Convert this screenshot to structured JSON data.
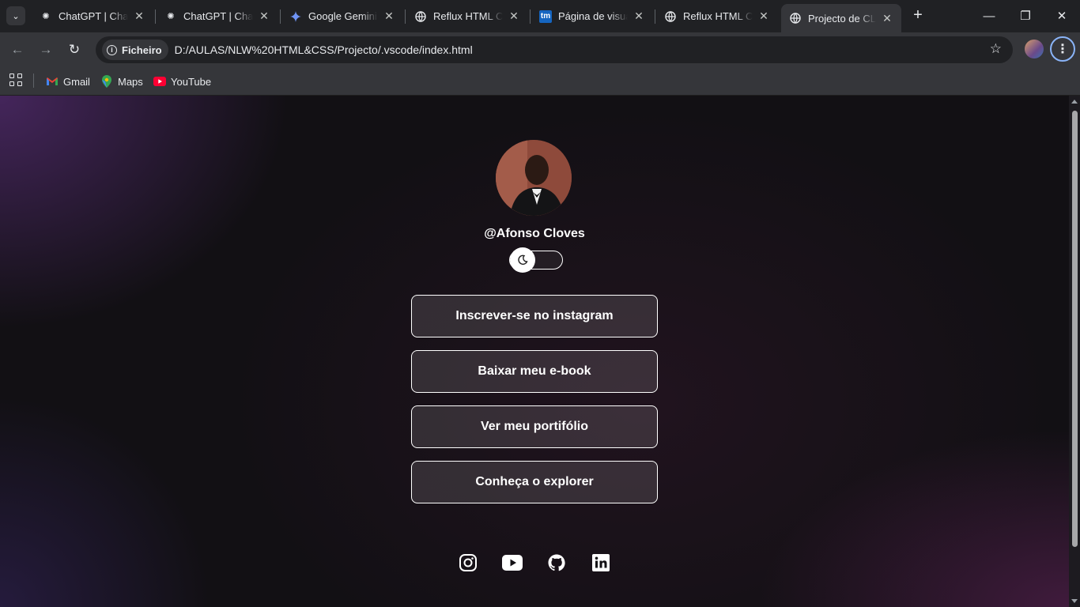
{
  "tabs": [
    {
      "title": "ChatGPT | Chat com IA",
      "favicon": "openai-icon"
    },
    {
      "title": "ChatGPT | Chat com IA",
      "favicon": "openai-icon"
    },
    {
      "title": "Google Gemini",
      "favicon": "gemini-icon"
    },
    {
      "title": "Reflux HTML CSS",
      "favicon": "globe-icon"
    },
    {
      "title": "Página de visualização",
      "favicon": "tm-icon",
      "favicon_text": "tm"
    },
    {
      "title": "Reflux HTML CSS",
      "favicon": "globe-icon"
    },
    {
      "title": "Projecto de CLOVES",
      "favicon": "globe-icon",
      "active": true
    }
  ],
  "address_bar": {
    "scheme_label": "Ficheiro",
    "url": "D:/AULAS/NLW%20HTML&CSS/Projecto/.vscode/index.html"
  },
  "bookmarks": [
    {
      "label": "Gmail",
      "icon": "gmail-icon"
    },
    {
      "label": "Maps",
      "icon": "maps-icon"
    },
    {
      "label": "YouTube",
      "icon": "youtube-icon"
    }
  ],
  "profile": {
    "handle": "@Afonso Cloves",
    "theme_switch": {
      "state": "dark",
      "icon": "moon-icon"
    }
  },
  "links": [
    {
      "label": "Inscrever-se no instagram"
    },
    {
      "label": "Baixar meu e-book"
    },
    {
      "label": "Ver meu portifólio"
    },
    {
      "label": "Conheça o explorer"
    }
  ],
  "social_icons": [
    "instagram-icon",
    "youtube-icon",
    "github-icon",
    "linkedin-icon"
  ],
  "colors": {
    "accent": "#8ab4f8",
    "background": "#121014",
    "button_border": "#ffffff",
    "text": "#ffffff"
  }
}
